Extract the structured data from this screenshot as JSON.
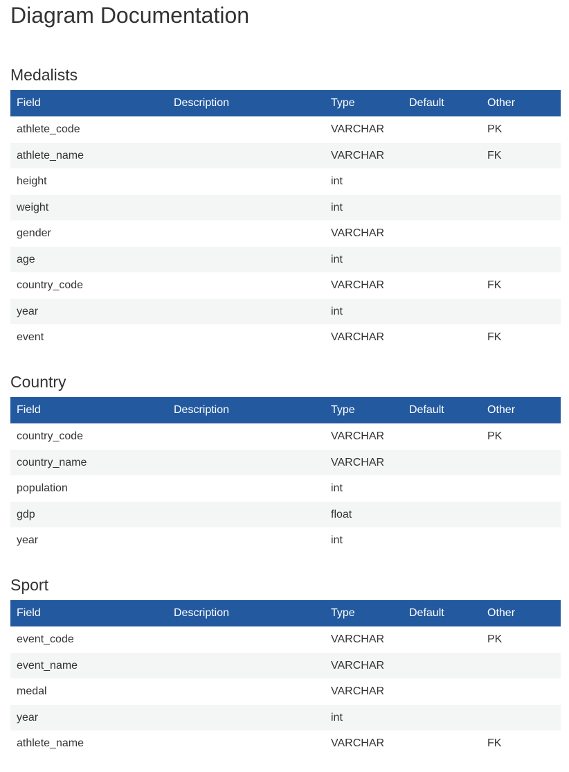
{
  "page_title": "Diagram Documentation",
  "header_color": "#23599e",
  "columns": [
    "Field",
    "Description",
    "Type",
    "Default",
    "Other"
  ],
  "tables": [
    {
      "name": "Medalists",
      "rows": [
        {
          "field": "athlete_code",
          "description": "",
          "type": "VARCHAR",
          "default": "",
          "other": "PK"
        },
        {
          "field": "athlete_name",
          "description": "",
          "type": "VARCHAR",
          "default": "",
          "other": "FK"
        },
        {
          "field": "height",
          "description": "",
          "type": "int",
          "default": "",
          "other": ""
        },
        {
          "field": "weight",
          "description": "",
          "type": "int",
          "default": "",
          "other": ""
        },
        {
          "field": "gender",
          "description": "",
          "type": "VARCHAR",
          "default": "",
          "other": ""
        },
        {
          "field": "age",
          "description": "",
          "type": "int",
          "default": "",
          "other": ""
        },
        {
          "field": "country_code",
          "description": "",
          "type": "VARCHAR",
          "default": "",
          "other": "FK"
        },
        {
          "field": "year",
          "description": "",
          "type": "int",
          "default": "",
          "other": ""
        },
        {
          "field": "event",
          "description": "",
          "type": "VARCHAR",
          "default": "",
          "other": "FK"
        }
      ]
    },
    {
      "name": "Country",
      "rows": [
        {
          "field": "country_code",
          "description": "",
          "type": "VARCHAR",
          "default": "",
          "other": "PK"
        },
        {
          "field": "country_name",
          "description": "",
          "type": "VARCHAR",
          "default": "",
          "other": ""
        },
        {
          "field": "population",
          "description": "",
          "type": "int",
          "default": "",
          "other": ""
        },
        {
          "field": "gdp",
          "description": "",
          "type": "float",
          "default": "",
          "other": ""
        },
        {
          "field": "year",
          "description": "",
          "type": "int",
          "default": "",
          "other": ""
        }
      ]
    },
    {
      "name": "Sport",
      "rows": [
        {
          "field": "event_code",
          "description": "",
          "type": "VARCHAR",
          "default": "",
          "other": "PK"
        },
        {
          "field": "event_name",
          "description": "",
          "type": "VARCHAR",
          "default": "",
          "other": ""
        },
        {
          "field": "medal",
          "description": "",
          "type": "VARCHAR",
          "default": "",
          "other": ""
        },
        {
          "field": "year",
          "description": "",
          "type": "int",
          "default": "",
          "other": ""
        },
        {
          "field": "athlete_name",
          "description": "",
          "type": "VARCHAR",
          "default": "",
          "other": "FK"
        }
      ]
    }
  ]
}
